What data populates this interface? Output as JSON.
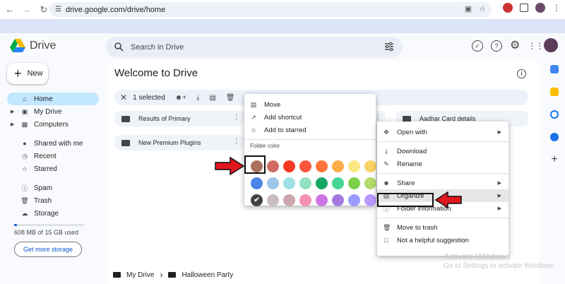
{
  "browser": {
    "url": "drive.google.com/drive/home"
  },
  "app": {
    "name": "Drive",
    "search_placeholder": "Search in Drive",
    "new_label": "New",
    "sidebar": {
      "items": [
        "Home",
        "My Drive",
        "Computers"
      ],
      "items2": [
        "Shared with me",
        "Recent",
        "Starred"
      ],
      "items3": [
        "Spam",
        "Trash",
        "Storage"
      ],
      "storage_text": "608 MB of 15 GB used",
      "storage_fraction": 0.04,
      "get_storage_label": "Get more storage"
    },
    "main": {
      "title": "Welcome to Drive",
      "selected_text": "1 selected",
      "folders": [
        "Results of Primary",
        "Aadhar Card details",
        "New Premium Plugins"
      ],
      "breadcrumb": [
        "My Drive",
        "Halloween Party"
      ]
    }
  },
  "left_menu": {
    "items": [
      "Move",
      "Add shortcut",
      "Add to starred"
    ],
    "folder_color_label": "Folder color",
    "swatches": [
      "#ac725e",
      "#d06b64",
      "#f83a22",
      "#fa573c",
      "#ff7537",
      "#ffad46",
      "#fbe983",
      "#fad165",
      "#4986e7",
      "#9fc6e7",
      "#9fe1e7",
      "#92e1c0",
      "#16a765",
      "#42d692",
      "#7bd148",
      "#b3dc6c",
      "#424242",
      "#cabdbf",
      "#cca6ac",
      "#f691b2",
      "#cd74e6",
      "#a47ae2",
      "#9a9cff",
      "#b99aff"
    ]
  },
  "right_menu": {
    "group1": [
      "Open with"
    ],
    "group2": [
      "Download",
      "Rename"
    ],
    "group3": [
      "Share",
      "Organize",
      "Folder information"
    ],
    "group4": [
      "Move to trash",
      "Not a helpful suggestion"
    ]
  },
  "watermark": {
    "line1": "Activate Windows",
    "line2": "Go to Settings to activate Windows."
  },
  "colors": {
    "accent": "#0b57d0",
    "active_nav": "#c2e7ff",
    "annotation_red": "#e1171e"
  }
}
